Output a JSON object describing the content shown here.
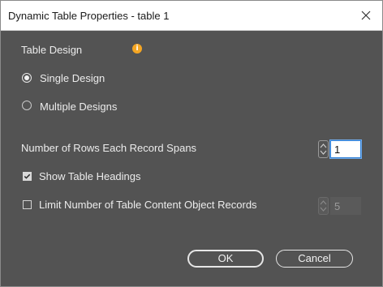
{
  "window": {
    "title": "Dynamic Table Properties - table 1"
  },
  "table_design": {
    "heading": "Table Design",
    "info_icon": "info-icon",
    "options": [
      {
        "label": "Single Design",
        "selected": true
      },
      {
        "label": "Multiple Designs",
        "selected": false
      }
    ]
  },
  "rows_span": {
    "label": "Number of Rows Each Record Spans",
    "value": "1"
  },
  "show_headings": {
    "label": "Show Table Headings",
    "checked": true
  },
  "limit_records": {
    "label": "Limit Number of Table Content Object Records",
    "checked": false,
    "value": "5"
  },
  "buttons": {
    "ok": "OK",
    "cancel": "Cancel"
  },
  "colors": {
    "panel_bg": "#535353",
    "info_accent": "#f5a623",
    "focus_ring": "#2f7fd6"
  }
}
